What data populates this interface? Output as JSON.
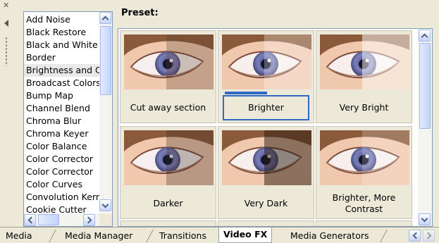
{
  "effects": {
    "items": [
      "Add Noise",
      "Black Restore",
      "Black and White",
      "Border",
      "Brightness and C",
      "Broadcast Colors",
      "Bump Map",
      "Channel Blend",
      "Chroma Blur",
      "Chroma Keyer",
      "Color Balance",
      "Color Corrector",
      "Color Corrector",
      "Color Curves",
      "Convolution Kerr",
      "Cookie Cutter"
    ],
    "selected_index": 4
  },
  "preset": {
    "label": "Preset:",
    "items": [
      {
        "caption": "Cut away section"
      },
      {
        "caption": "Brighter"
      },
      {
        "caption": "Very Bright"
      },
      {
        "caption": "Darker"
      },
      {
        "caption": "Very Dark"
      },
      {
        "caption": "Brighter, More Contrast"
      }
    ],
    "focused_index": 1
  },
  "tabs": {
    "items": [
      "Media",
      "Media Manager",
      "Transitions",
      "Video FX",
      "Media Generators"
    ],
    "active": "Video FX"
  },
  "colors": {
    "accent": "#3169c6",
    "panel_bg": "#ece9d8"
  },
  "icons": {
    "close": "close-icon",
    "collapse": "collapse-left-icon",
    "grip": "grip-handle-icon"
  }
}
